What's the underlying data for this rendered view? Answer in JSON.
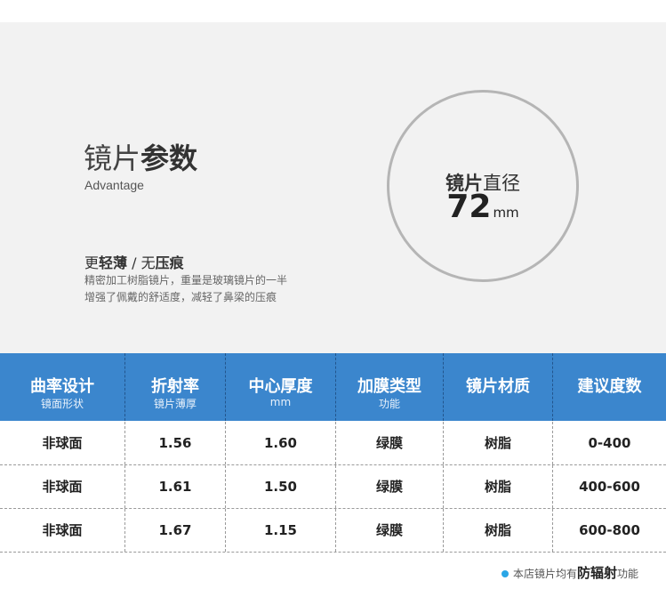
{
  "header": {
    "title_light": "镜片",
    "title_bold": "参数",
    "subtitle": "Advantage"
  },
  "feature": {
    "heading_a": "更",
    "heading_b": "轻薄",
    "heading_c": " / 无",
    "heading_d": "压痕",
    "desc_lines": [
      "精密加工树脂镜片，重量是玻璃镜片的一半",
      "增强了佩戴的舒适度，减轻了鼻梁的压痕"
    ]
  },
  "diameter": {
    "label_bold": "镜片",
    "label_light": "直径",
    "value": "72",
    "unit": "mm"
  },
  "table": {
    "columns": [
      {
        "title": "曲率设计",
        "sub": "镜面形状"
      },
      {
        "title": "折射率",
        "sub": "镜片薄厚"
      },
      {
        "title": "中心厚度",
        "sub": "mm"
      },
      {
        "title": "加膜类型",
        "sub": "功能"
      },
      {
        "title": "镜片材质",
        "sub": ""
      },
      {
        "title": "建议度数",
        "sub": ""
      }
    ],
    "rows": [
      [
        "非球面",
        "1.56",
        "1.60",
        "绿膜",
        "树脂",
        "0-400"
      ],
      [
        "非球面",
        "1.61",
        "1.50",
        "绿膜",
        "树脂",
        "400-600"
      ],
      [
        "非球面",
        "1.67",
        "1.15",
        "绿膜",
        "树脂",
        "600-800"
      ]
    ]
  },
  "footnote": {
    "prefix": "本店镜片均有",
    "emphasis": "防辐射",
    "suffix": "功能"
  },
  "colors": {
    "header_blue": "#3b86cd",
    "band_gray": "#f2f2f2",
    "dot_blue": "#2aa6e6"
  }
}
